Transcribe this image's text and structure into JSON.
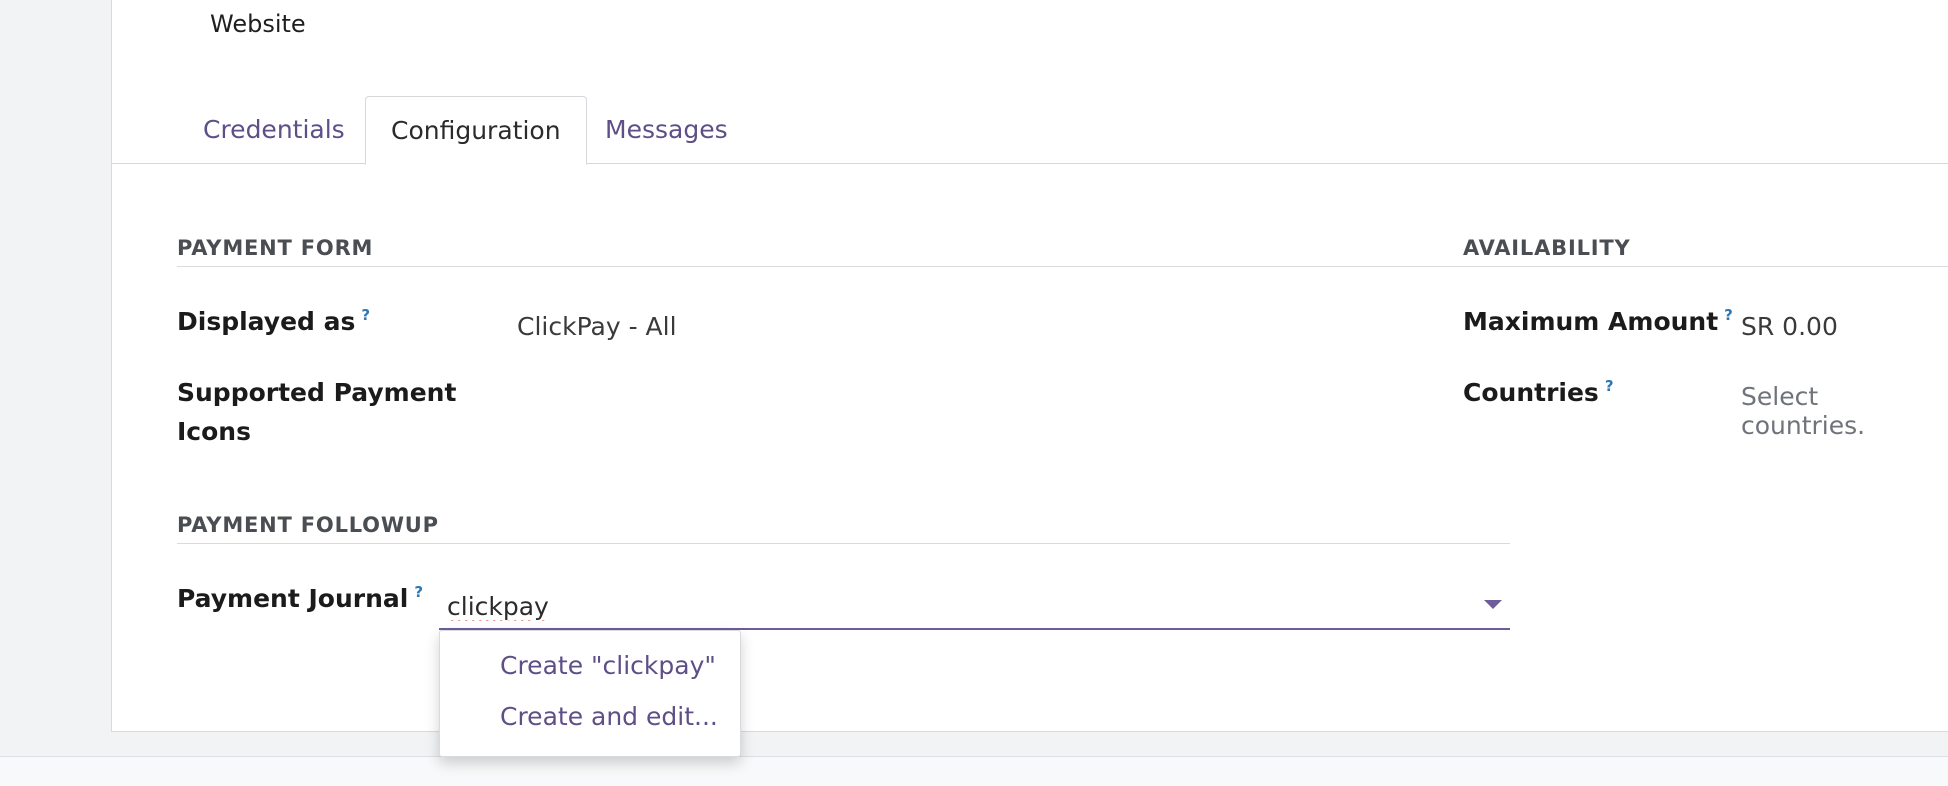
{
  "header": {
    "website_label": "Website"
  },
  "tabs": [
    {
      "label": "Credentials"
    },
    {
      "label": "Configuration"
    },
    {
      "label": "Messages"
    }
  ],
  "payment_form": {
    "title": "PAYMENT FORM",
    "displayed_as_label": "Displayed as",
    "displayed_as_value": "ClickPay - All",
    "supported_icons_label_line1": "Supported Payment",
    "supported_icons_label_line2": "Icons"
  },
  "availability": {
    "title": "AVAILABILITY",
    "max_amount_label": "Maximum Amount",
    "max_amount_value": "SR 0.00",
    "countries_label": "Countries",
    "countries_placeholder": "Select countries."
  },
  "payment_followup": {
    "title": "PAYMENT FOLLOWUP",
    "journal_label": "Payment Journal",
    "journal_value": "clickpay"
  },
  "dropdown": {
    "items": [
      {
        "label": "Create \"clickpay\""
      },
      {
        "label": "Create and edit..."
      }
    ]
  },
  "help_marker": "?",
  "colors": {
    "link": "#5e4f87",
    "help": "#2f77b3",
    "accent_underline": "#6f5d9a"
  }
}
